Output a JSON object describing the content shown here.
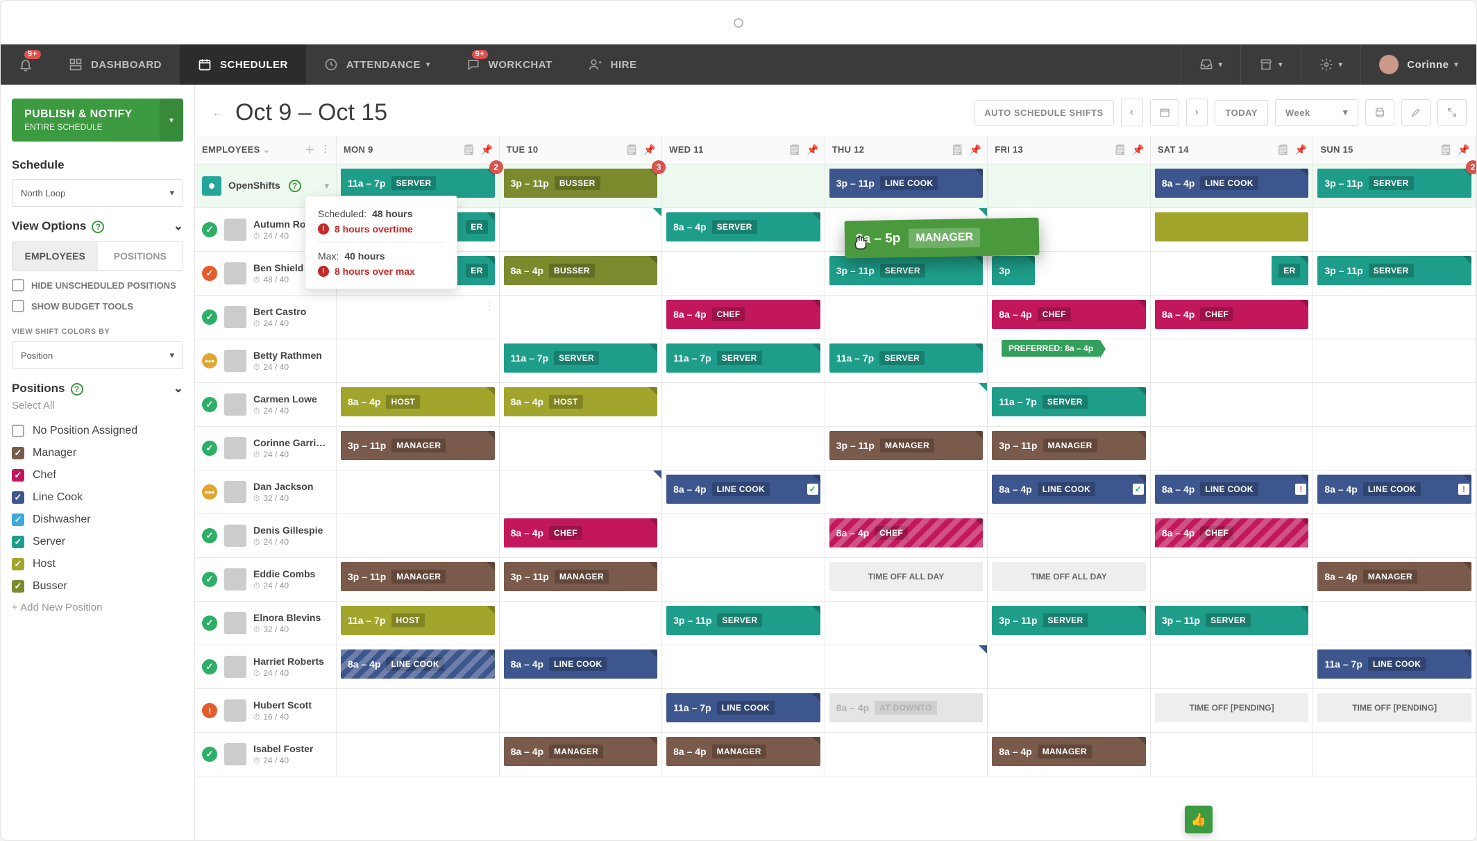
{
  "nav": {
    "notif_badge": "9+",
    "dashboard": "DASHBOARD",
    "scheduler": "SCHEDULER",
    "attendance": "ATTENDANCE",
    "workchat": "WORKCHAT",
    "workchat_badge": "9+",
    "hire": "HIRE",
    "user": "Corinne"
  },
  "sidebar": {
    "publish_title": "PUBLISH & NOTIFY",
    "publish_sub": "ENTIRE SCHEDULE",
    "schedule_label": "Schedule",
    "schedule_value": "North Loop",
    "viewopts_label": "View Options",
    "tab_employees": "EMPLOYEES",
    "tab_positions": "POSITIONS",
    "hide_unscheduled": "HIDE UNSCHEDULED POSITIONS",
    "show_budget": "SHOW BUDGET TOOLS",
    "view_colors_label": "VIEW SHIFT COLORS BY",
    "view_colors_value": "Position",
    "positions_label": "Positions",
    "select_all": "Select All",
    "add_position": "+ Add New Position",
    "positions": [
      {
        "name": "No Position Assigned",
        "color": "",
        "checked": false
      },
      {
        "name": "Manager",
        "color": "cb-manager",
        "checked": true
      },
      {
        "name": "Chef",
        "color": "cb-chef",
        "checked": true
      },
      {
        "name": "Line Cook",
        "color": "cb-linecook",
        "checked": true
      },
      {
        "name": "Dishwasher",
        "color": "cb-dishwasher",
        "checked": true
      },
      {
        "name": "Server",
        "color": "cb-server",
        "checked": true
      },
      {
        "name": "Host",
        "color": "cb-host",
        "checked": true
      },
      {
        "name": "Busser",
        "color": "cb-busser",
        "checked": true
      }
    ]
  },
  "toolbar": {
    "range": "Oct 9 – Oct 15",
    "auto": "AUTO SCHEDULE SHIFTS",
    "today": "TODAY",
    "view": "Week"
  },
  "days": [
    "MON 9",
    "TUE 10",
    "WED 11",
    "THU 12",
    "FRI 13",
    "SAT 14",
    "SUN 15"
  ],
  "employees_header": "EMPLOYEES",
  "openshifts_label": "OpenShifts",
  "tooltip": {
    "sched_label": "Scheduled:",
    "sched_val": "48 hours",
    "overtime": "8 hours overtime",
    "max_label": "Max:",
    "max_val": "40 hours",
    "overmax": "8 hours over max"
  },
  "drag": {
    "time": "9a – 5p",
    "role": "MANAGER"
  },
  "pref_tag": "PREFERRED: 8a – 4p",
  "rows": [
    {
      "type": "open",
      "cells": [
        {
          "badge": "2",
          "shift": {
            "time": "11a – 7p",
            "role": "SERVER",
            "cls": "clr-server"
          }
        },
        {
          "badge": "3",
          "shift": {
            "time": "3p – 11p",
            "role": "BUSSER",
            "cls": "clr-busser"
          }
        },
        {},
        {
          "shift": {
            "time": "3p – 11p",
            "role": "LINE COOK",
            "cls": "clr-linecook"
          }
        },
        {},
        {
          "shift": {
            "time": "8a – 4p",
            "role": "LINE COOK",
            "cls": "clr-linecook"
          }
        },
        {
          "badge": "2",
          "shift": {
            "time": "3p – 11p",
            "role": "SERVER",
            "cls": "clr-server"
          }
        }
      ]
    },
    {
      "name": "Autumn Ro…",
      "hours": "24 / 40",
      "status": "ok",
      "cells": [
        {
          "shift": {
            "time": "",
            "role": "ER",
            "cls": "clr-server",
            "half": true
          }
        },
        {
          "corner": "#1e9e8a"
        },
        {
          "shift": {
            "time": "8a – 4p",
            "role": "SERVER",
            "cls": "clr-server"
          }
        },
        {
          "corner": "#1e9e8a"
        },
        {},
        {
          "shift": {
            "time": "",
            "role": "",
            "cls": "clr-host",
            "blank": true
          }
        },
        {}
      ]
    },
    {
      "name": "Ben Shield…",
      "hours": "48 / 40",
      "status": "alert",
      "cells": [
        {
          "shift": {
            "time": "",
            "role": "ER",
            "cls": "clr-server",
            "half": true
          }
        },
        {
          "shift": {
            "time": "8a – 4p",
            "role": "BUSSER",
            "cls": "clr-busser"
          }
        },
        {},
        {
          "shift": {
            "time": "3p – 11p",
            "role": "SERVER",
            "cls": "clr-server"
          }
        },
        {
          "shift": {
            "time": "3p",
            "role": "",
            "cls": "clr-server",
            "partial": true
          }
        },
        {
          "shift": {
            "time": "",
            "role": "ER",
            "cls": "clr-server",
            "tiny": true
          }
        },
        {
          "shift": {
            "time": "3p – 11p",
            "role": "SERVER",
            "cls": "clr-server"
          }
        }
      ]
    },
    {
      "name": "Bert Castro",
      "hours": "24 / 40",
      "status": "ok",
      "cells": [
        {
          "row_menu": true
        },
        {},
        {
          "shift": {
            "time": "8a – 4p",
            "role": "CHEF",
            "cls": "clr-chef"
          }
        },
        {},
        {
          "shift": {
            "time": "8a – 4p",
            "role": "CHEF",
            "cls": "clr-chef"
          }
        },
        {
          "shift": {
            "time": "8a – 4p",
            "role": "CHEF",
            "cls": "clr-chef"
          }
        },
        {}
      ]
    },
    {
      "name": "Betty Rathmen",
      "hours": "24 / 40",
      "status": "warn",
      "status_text": "•••",
      "cells": [
        {},
        {
          "shift": {
            "time": "11a – 7p",
            "role": "SERVER",
            "cls": "clr-server"
          }
        },
        {
          "shift": {
            "time": "11a – 7p",
            "role": "SERVER",
            "cls": "clr-server"
          }
        },
        {
          "shift": {
            "time": "11a – 7p",
            "role": "SERVER",
            "cls": "clr-server"
          }
        },
        {},
        {},
        {}
      ]
    },
    {
      "name": "Carmen Lowe",
      "hours": "24 / 40",
      "status": "ok",
      "cells": [
        {
          "shift": {
            "time": "8a – 4p",
            "role": "HOST",
            "cls": "clr-host"
          }
        },
        {
          "shift": {
            "time": "8a – 4p",
            "role": "HOST",
            "cls": "clr-host"
          }
        },
        {},
        {
          "corner": "#1e9e8a"
        },
        {
          "shift": {
            "time": "11a – 7p",
            "role": "SERVER",
            "cls": "clr-server"
          }
        },
        {},
        {
          "pref": true
        }
      ]
    },
    {
      "name": "Corinne Garris…",
      "hours": "24 / 40",
      "status": "ok",
      "cells": [
        {
          "shift": {
            "time": "3p – 11p",
            "role": "MANAGER",
            "cls": "clr-manager"
          }
        },
        {},
        {},
        {
          "shift": {
            "time": "3p – 11p",
            "role": "MANAGER",
            "cls": "clr-manager"
          }
        },
        {
          "shift": {
            "time": "3p – 11p",
            "role": "MANAGER",
            "cls": "clr-manager"
          }
        },
        {},
        {}
      ]
    },
    {
      "name": "Dan Jackson",
      "hours": "32 / 40",
      "status": "warn",
      "status_text": "•••",
      "cells": [
        {},
        {
          "corner": "#3d568e"
        },
        {
          "shift": {
            "time": "8a – 4p",
            "role": "LINE COOK",
            "cls": "clr-linecook",
            "mark": "check"
          }
        },
        {},
        {
          "shift": {
            "time": "8a – 4p",
            "role": "LINE COOK",
            "cls": "clr-linecook",
            "mark": "check"
          }
        },
        {
          "shift": {
            "time": "8a – 4p",
            "role": "LINE COOK",
            "cls": "clr-linecook",
            "mark": "alert"
          }
        },
        {
          "shift": {
            "time": "8a – 4p",
            "role": "LINE COOK",
            "cls": "clr-linecook",
            "mark": "alert"
          }
        }
      ]
    },
    {
      "name": "Denis Gillespie",
      "hours": "24 / 40",
      "status": "ok",
      "cells": [
        {},
        {
          "shift": {
            "time": "8a – 4p",
            "role": "CHEF",
            "cls": "clr-chef"
          }
        },
        {},
        {
          "shift": {
            "time": "8a – 4p",
            "role": "CHEF",
            "cls": "clr-chef",
            "striped": true
          }
        },
        {},
        {
          "shift": {
            "time": "8a – 4p",
            "role": "CHEF",
            "cls": "clr-chef",
            "striped": true
          }
        },
        {}
      ]
    },
    {
      "name": "Eddie Combs",
      "hours": "24 / 40",
      "status": "ok",
      "cells": [
        {
          "shift": {
            "time": "3p – 11p",
            "role": "MANAGER",
            "cls": "clr-manager"
          }
        },
        {
          "shift": {
            "time": "3p – 11p",
            "role": "MANAGER",
            "cls": "clr-manager"
          }
        },
        {},
        {
          "shift": {
            "time": "TIME OFF ALL DAY",
            "cls": "timeoff"
          }
        },
        {
          "shift": {
            "time": "TIME OFF ALL DAY",
            "cls": "timeoff"
          }
        },
        {},
        {
          "shift": {
            "time": "8a – 4p",
            "role": "MANAGER",
            "cls": "clr-manager"
          }
        }
      ]
    },
    {
      "name": "Elnora Blevins",
      "hours": "32 / 40",
      "status": "ok",
      "cells": [
        {
          "shift": {
            "time": "11a – 7p",
            "role": "HOST",
            "cls": "clr-host"
          }
        },
        {},
        {
          "shift": {
            "time": "3p – 11p",
            "role": "SERVER",
            "cls": "clr-server"
          }
        },
        {},
        {
          "shift": {
            "time": "3p – 11p",
            "role": "SERVER",
            "cls": "clr-server"
          }
        },
        {
          "shift": {
            "time": "3p – 11p",
            "role": "SERVER",
            "cls": "clr-server"
          }
        },
        {}
      ]
    },
    {
      "name": "Harriet Roberts",
      "hours": "24 / 40",
      "status": "ok",
      "cells": [
        {
          "shift": {
            "time": "8a – 4p",
            "role": "LINE COOK",
            "cls": "clr-linecook",
            "striped": true
          }
        },
        {
          "shift": {
            "time": "8a – 4p",
            "role": "LINE COOK",
            "cls": "clr-linecook"
          }
        },
        {},
        {
          "corner": "#3d568e"
        },
        {},
        {},
        {
          "shift": {
            "time": "11a – 7p",
            "role": "LINE COOK",
            "cls": "clr-linecook"
          }
        }
      ]
    },
    {
      "name": "Hubert Scott",
      "hours": "16 / 40",
      "status": "alert",
      "status_icon": "!",
      "cells": [
        {},
        {},
        {
          "shift": {
            "time": "11a – 7p",
            "role": "LINE COOK",
            "cls": "clr-linecook"
          }
        },
        {
          "shift": {
            "time": "8a – 4p",
            "role": "AT DOWNTO",
            "cls": "ghost"
          }
        },
        {},
        {
          "shift": {
            "time": "TIME OFF [PENDING]",
            "cls": "timeoff"
          }
        },
        {
          "shift": {
            "time": "TIME OFF [PENDING]",
            "cls": "timeoff"
          }
        }
      ]
    },
    {
      "name": "Isabel Foster",
      "hours": "24 / 40",
      "status": "ok",
      "cells": [
        {},
        {
          "shift": {
            "time": "8a – 4p",
            "role": "MANAGER",
            "cls": "clr-manager"
          }
        },
        {
          "shift": {
            "time": "8a – 4p",
            "role": "MANAGER",
            "cls": "clr-manager"
          }
        },
        {},
        {
          "shift": {
            "time": "8a – 4p",
            "role": "MANAGER",
            "cls": "clr-manager"
          }
        },
        {},
        {}
      ]
    }
  ]
}
